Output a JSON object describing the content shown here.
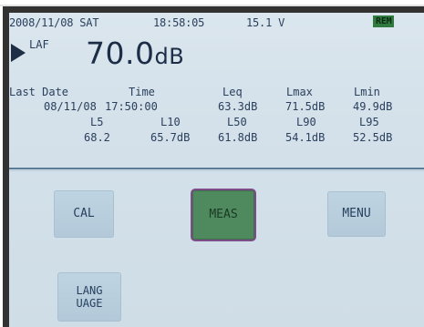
{
  "status": {
    "date": "2008/11/08 SAT",
    "time": "18:58:05",
    "voltage": "15.1 V",
    "rem": "REM"
  },
  "level": {
    "weighting": "LAF",
    "value": "70.0",
    "unit": "dB"
  },
  "table": {
    "header": [
      "Last Date",
      "Time",
      "Leq",
      "Lmax",
      "Lmin"
    ],
    "row1": [
      "08/11/08",
      "17:50:00",
      "63.3dB",
      "71.5dB",
      "49.9dB"
    ],
    "percentile_labels": [
      "L5",
      "L10",
      "L50",
      "L90",
      "L95"
    ],
    "percentile_values": [
      "68.2",
      "65.7dB",
      "61.8dB",
      "54.1dB",
      "52.5dB"
    ]
  },
  "buttons": {
    "cal": "CAL",
    "meas": "MEAS",
    "menu": "MENU",
    "language_line1": "LANG",
    "language_line2": "UAGE"
  },
  "colors": {
    "screen_bg": "#d6e2eb",
    "active_button": "#4f8a5f",
    "rem_badge": "#2f7a3f"
  }
}
